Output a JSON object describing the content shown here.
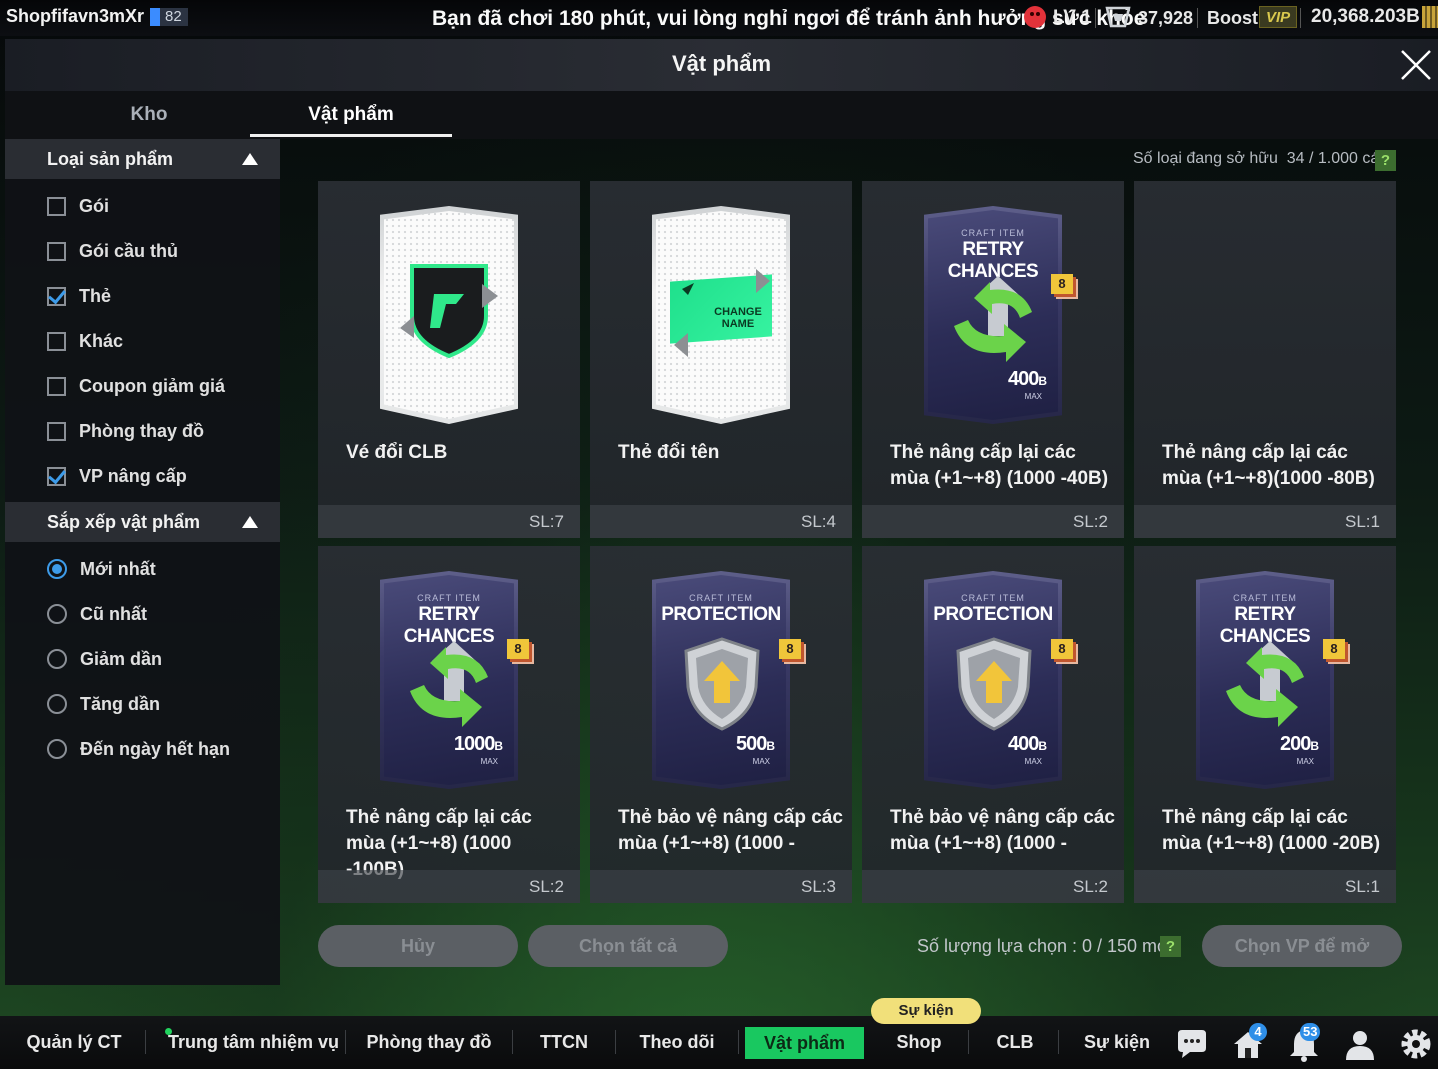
{
  "topbar": {
    "username": "Shopfifavn3mXr",
    "level_progress": "82",
    "notice": "Bạn đã chơi 180 phút, vui lòng nghỉ ngơi để tránh ảnh hưởng sức khỏe",
    "level": "LV 1",
    "coins": "37,928",
    "boost_label": "Boost",
    "vip_label": "VIP",
    "bp": "20,368.203B"
  },
  "window": {
    "title": "Vật phẩm"
  },
  "tabs": [
    {
      "label": "Kho",
      "active": false
    },
    {
      "label": "Vật phẩm",
      "active": true
    }
  ],
  "filters": {
    "category_title": "Loại sản phẩm",
    "categories": [
      {
        "label": "Gói",
        "checked": false
      },
      {
        "label": "Gói cầu thủ",
        "checked": false
      },
      {
        "label": "Thẻ",
        "checked": true
      },
      {
        "label": "Khác",
        "checked": false
      },
      {
        "label": "Coupon giảm giá",
        "checked": false
      },
      {
        "label": "Phòng thay đồ",
        "checked": false
      },
      {
        "label": "VP nâng cấp",
        "checked": true
      }
    ],
    "sort_title": "Sắp xếp vật phẩm",
    "sort_options": [
      {
        "label": "Mới nhất",
        "selected": true
      },
      {
        "label": "Cũ nhất",
        "selected": false
      },
      {
        "label": "Giảm dần",
        "selected": false
      },
      {
        "label": "Tăng dần",
        "selected": false
      },
      {
        "label": "Đến ngày hết hạn",
        "selected": false
      }
    ]
  },
  "owned": {
    "label": "Số loại đang sở hữu",
    "value": "34 / 1.000 cái",
    "help": "?"
  },
  "items": [
    {
      "name": "Vé đổi CLB",
      "qty": "SL:7",
      "art": "club-change-ticket"
    },
    {
      "name": "Thẻ đổi tên",
      "qty": "SL:4",
      "art": "name-change-card",
      "art_text": "CHANGE NAME"
    },
    {
      "name": "Thẻ nâng cấp lại các mùa (+1~+8) (1000 -40B)",
      "qty": "SL:2",
      "art": "retry-chances",
      "craft_sub": "CRAFT ITEM",
      "craft_title": "RETRY CHANCES",
      "badge": "8",
      "cap": "400",
      "cap_unit": "B",
      "cap_max": "MAX"
    },
    {
      "name": "Thẻ nâng cấp lại các mùa (+1~+8)(1000 -80B)",
      "qty": "SL:1",
      "art": "none"
    },
    {
      "name": "Thẻ nâng cấp lại các mùa (+1~+8) (1000 -100B)",
      "qty": "SL:2",
      "art": "retry-chances",
      "craft_sub": "CRAFT ITEM",
      "craft_title": "RETRY CHANCES",
      "badge": "8",
      "cap": "1000",
      "cap_unit": "B",
      "cap_max": "MAX"
    },
    {
      "name": "Thẻ bảo vệ nâng cấp các mùa (+1~+8) (1000 -",
      "qty": "SL:3",
      "art": "protection",
      "craft_sub": "CRAFT ITEM",
      "craft_title": "PROTECTION",
      "badge": "8",
      "cap": "500",
      "cap_unit": "B",
      "cap_max": "MAX"
    },
    {
      "name": "Thẻ bảo vệ nâng cấp các mùa (+1~+8) (1000 -",
      "qty": "SL:2",
      "art": "protection",
      "craft_sub": "CRAFT ITEM",
      "craft_title": "PROTECTION",
      "badge": "8",
      "cap": "400",
      "cap_unit": "B",
      "cap_max": "MAX"
    },
    {
      "name": "Thẻ nâng cấp lại các mùa (+1~+8) (1000 -20B)",
      "qty": "SL:1",
      "art": "retry-chances",
      "craft_sub": "CRAFT ITEM",
      "craft_title": "RETRY CHANCES",
      "badge": "8",
      "cap": "200",
      "cap_unit": "B",
      "cap_max": "MAX"
    }
  ],
  "actions": {
    "cancel": "Hủy",
    "select_all": "Chọn tất cả",
    "selection_count": "Số lượng lựa chọn : 0 / 150 món",
    "open_selected": "Chọn VP để mở"
  },
  "nav": {
    "event_tag": "Sự kiện",
    "items": [
      {
        "label": "Quản lý CT",
        "active": false
      },
      {
        "label": "Trung tâm nhiệm vụ",
        "active": false
      },
      {
        "label": "Phòng thay đồ",
        "active": false
      },
      {
        "label": "TTCN",
        "active": false
      },
      {
        "label": "Theo dõi",
        "active": false
      },
      {
        "label": "Vật phẩm",
        "active": true
      },
      {
        "label": "Shop",
        "active": false
      },
      {
        "label": "CLB",
        "active": false
      },
      {
        "label": "Sự kiện",
        "active": false
      }
    ],
    "icons": [
      {
        "name": "chat-icon"
      },
      {
        "name": "home-icon",
        "badge": "4"
      },
      {
        "name": "bell-icon",
        "badge": "53"
      },
      {
        "name": "profile-icon"
      },
      {
        "name": "settings-icon"
      }
    ]
  },
  "colors": {
    "accent": "#19c860",
    "check": "#3d9be9",
    "card": "#2a2e34"
  }
}
